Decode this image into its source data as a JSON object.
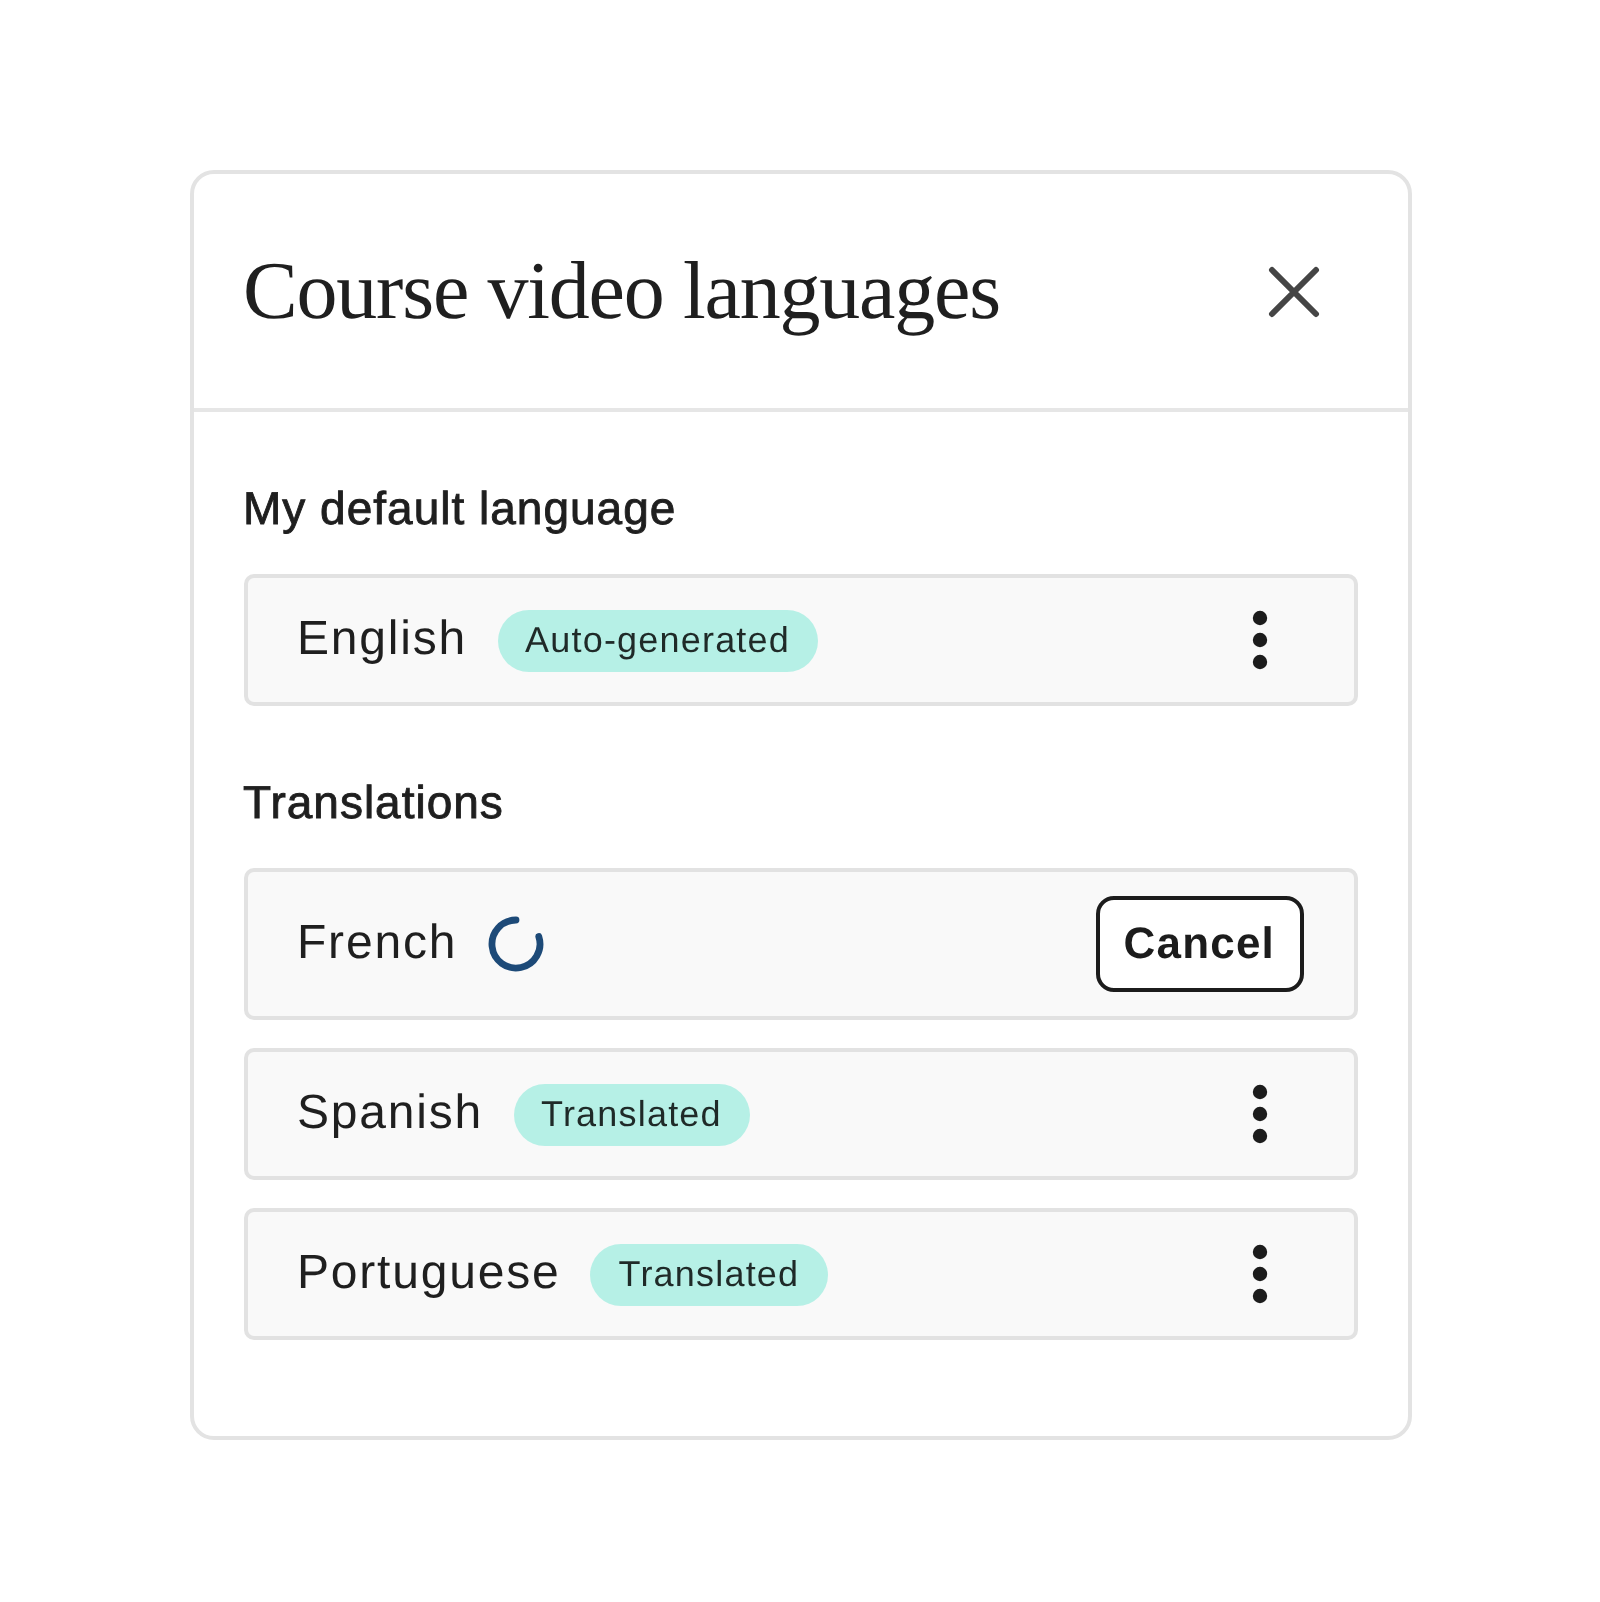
{
  "dialog": {
    "title": "Course video languages"
  },
  "sections": [
    {
      "heading": "My default language",
      "items": [
        {
          "kind": "done",
          "language": "English",
          "badge": "Auto-generated"
        }
      ]
    },
    {
      "heading": "Translations",
      "items": [
        {
          "kind": "translating",
          "language": "French",
          "button": "Cancel"
        },
        {
          "kind": "done",
          "language": "Spanish",
          "badge": "Translated"
        },
        {
          "kind": "done",
          "language": "Portuguese",
          "badge": "Translated"
        }
      ]
    }
  ]
}
